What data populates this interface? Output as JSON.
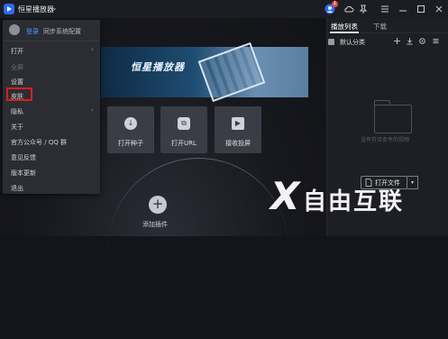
{
  "titlebar": {
    "app_name": "恒星播放器",
    "chevron": "⌄",
    "badge_count": "1",
    "icons": [
      "avatar-icon",
      "cloud-icon",
      "pin-icon",
      "menu-icon",
      "minimize-icon",
      "restore-icon",
      "close-icon"
    ]
  },
  "menu": {
    "login_label": "登录",
    "sync_label": "同步系统配置",
    "items": [
      {
        "label": "打开",
        "submenu": true,
        "disabled": false
      },
      {
        "label": "全屏",
        "submenu": false,
        "disabled": true
      },
      {
        "label": "设置",
        "submenu": false,
        "disabled": false
      },
      {
        "label": "皮肤",
        "submenu": false,
        "disabled": false
      },
      {
        "label": "隐私",
        "submenu": true,
        "disabled": false
      },
      {
        "label": "关于",
        "submenu": false,
        "disabled": false
      },
      {
        "label": "官方公众号 / QQ 群",
        "submenu": false,
        "disabled": false
      },
      {
        "label": "意见反馈",
        "submenu": false,
        "disabled": false
      },
      {
        "label": "版本更新",
        "submenu": false,
        "disabled": false
      },
      {
        "label": "退出",
        "submenu": false,
        "disabled": false
      }
    ],
    "arrow": "›",
    "highlight_color": "#d52020"
  },
  "main": {
    "banner_text": "恒星播放器",
    "tiles": [
      {
        "label": "打开种子",
        "icon": "download-icon",
        "glyph": "↓"
      },
      {
        "label": "打开URL",
        "icon": "link-icon",
        "glyph": "⧉"
      },
      {
        "label": "接收投屏",
        "icon": "cast-icon",
        "glyph": "▶"
      }
    ],
    "add_glyph": "+",
    "add_label": "添加插件"
  },
  "panel": {
    "tab_play": "播放列表",
    "tab_download": "下载",
    "category_label": "默认分类",
    "icons": [
      "add-icon",
      "download-icon",
      "settings-icon",
      "more-icon"
    ],
    "empty_text": "没有符合条件的视频",
    "open_file_label": "打开文件",
    "dropdown_glyph": "▾"
  },
  "watermark": {
    "logo": "X",
    "text": "自由互联"
  },
  "colors": {
    "accent": "#2a6bf2",
    "link": "#4e9bff",
    "badge": "#e84a4a"
  }
}
